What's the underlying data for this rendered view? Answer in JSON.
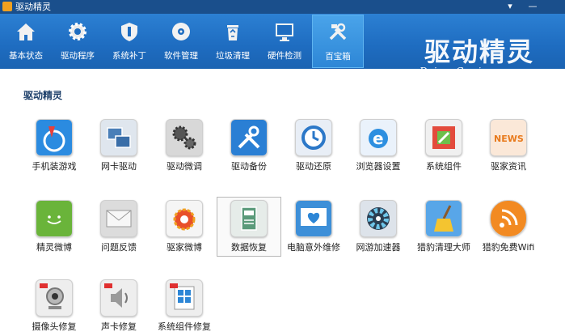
{
  "window": {
    "title": "驱动精灵",
    "controls": [
      "▾",
      "—"
    ]
  },
  "toolbar": {
    "items": [
      {
        "label": "基本状态",
        "icon": "home-icon"
      },
      {
        "label": "驱动程序",
        "icon": "gear-icon"
      },
      {
        "label": "系统补丁",
        "icon": "shield-icon"
      },
      {
        "label": "软件管理",
        "icon": "disc-icon"
      },
      {
        "label": "垃圾清理",
        "icon": "recycle-bin-icon"
      },
      {
        "label": "硬件检测",
        "icon": "monitor-icon"
      },
      {
        "label": "百宝箱",
        "icon": "tools-icon",
        "active": true
      }
    ]
  },
  "brand": {
    "name": "驱动精灵",
    "url": "DriverGenius.com"
  },
  "section": {
    "title": "驱动精灵"
  },
  "apps": [
    {
      "label": "手机装游戏",
      "icon": "phone-game-icon",
      "color": "#2b8be0"
    },
    {
      "label": "网卡驱动",
      "icon": "network-card-icon",
      "color": "#dfe6ee"
    },
    {
      "label": "驱动微调",
      "icon": "gears-icon",
      "color": "#d8d8d8"
    },
    {
      "label": "驱动备份",
      "icon": "wrench-tools-icon",
      "color": "#2a7fd4"
    },
    {
      "label": "驱动还原",
      "icon": "restore-clock-icon",
      "color": "#e8eef6"
    },
    {
      "label": "浏览器设置",
      "icon": "ie-browser-icon",
      "color": "#eaf2fb"
    },
    {
      "label": "系统组件",
      "icon": "system-component-icon",
      "color": "#f0f0f0"
    },
    {
      "label": "驱家资讯",
      "icon": "news-icon",
      "color": "#fbe8d8"
    },
    {
      "label": "精灵微博",
      "icon": "smile-chat-icon",
      "color": "#6ab43a"
    },
    {
      "label": "问题反馈",
      "icon": "envelope-icon",
      "color": "#dcdcdc"
    },
    {
      "label": "驱家微博",
      "icon": "weibo-icon",
      "color": "#f5f5f5"
    },
    {
      "label": "数据恢复",
      "icon": "data-recovery-icon",
      "color": "#e6ece9",
      "hover": true
    },
    {
      "label": "电脑意外维修",
      "icon": "heart-monitor-icon",
      "color": "#3d8fd8"
    },
    {
      "label": "网游加速器",
      "icon": "fan-accelerator-icon",
      "color": "#dde3ea"
    },
    {
      "label": "猎豹清理大师",
      "icon": "broom-icon",
      "color": "#58a6e8"
    },
    {
      "label": "猎豹免费Wifi",
      "icon": "wifi-icon",
      "color": "#f28a22"
    },
    {
      "label": "摄像头修复",
      "icon": "webcam-icon",
      "color": "#eeeeee"
    },
    {
      "label": "声卡修复",
      "icon": "speaker-icon",
      "color": "#eeeeee"
    },
    {
      "label": "系统组件修复",
      "icon": "windows-repair-icon",
      "color": "#eeeeee"
    }
  ]
}
